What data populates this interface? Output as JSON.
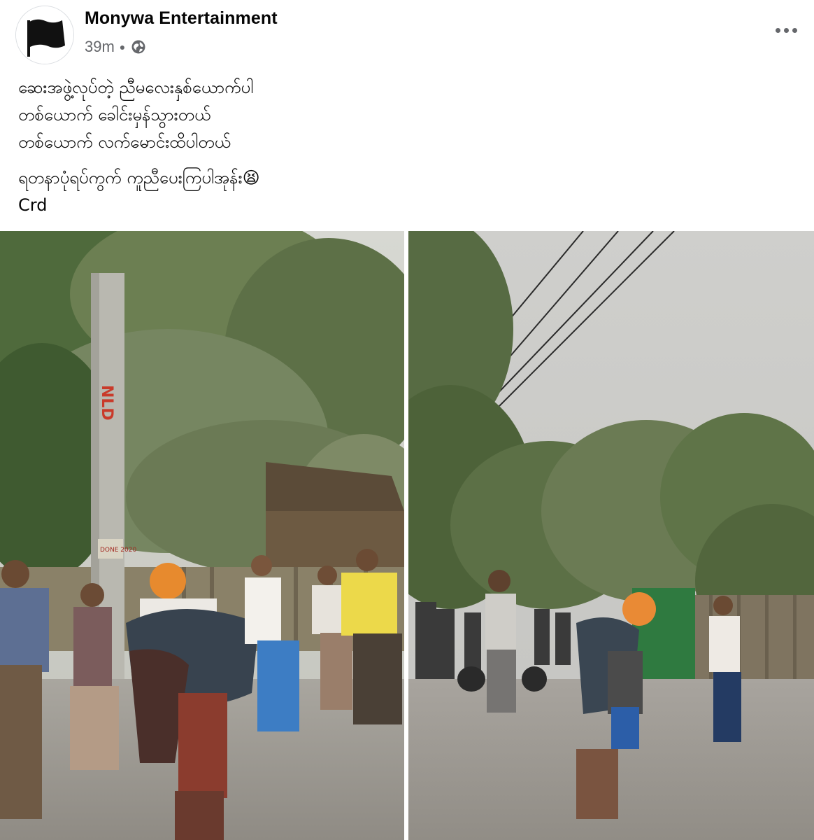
{
  "post": {
    "author_name": "Monywa Entertainment",
    "timestamp": "39m",
    "audience_icon": "globe-icon",
    "more_options_icon": "more-horizontal-icon",
    "avatar_icon": "black-flag-icon",
    "text_lines": [
      "ဆေးအဖွဲ့လုပ်တဲ့ ညီမလေးနှစ်ယောက်ပါ",
      "တစ်ယောက် ခေါင်းမှန်သွားတယ်",
      "တစ်ယောက် လက်မောင်းထိပါတယ်",
      "ရတနာပုံရပ်ကွက် ကူညီပေးကြပါအုန်း😫",
      "Crd"
    ]
  },
  "photos": [
    {
      "name": "photo-street-left",
      "pole_sign_text": "NLD",
      "pole_label_text": "DONE 2020"
    },
    {
      "name": "photo-street-right"
    }
  ],
  "colors": {
    "text_primary": "#050505",
    "text_secondary": "#65676b",
    "background": "#ffffff"
  }
}
